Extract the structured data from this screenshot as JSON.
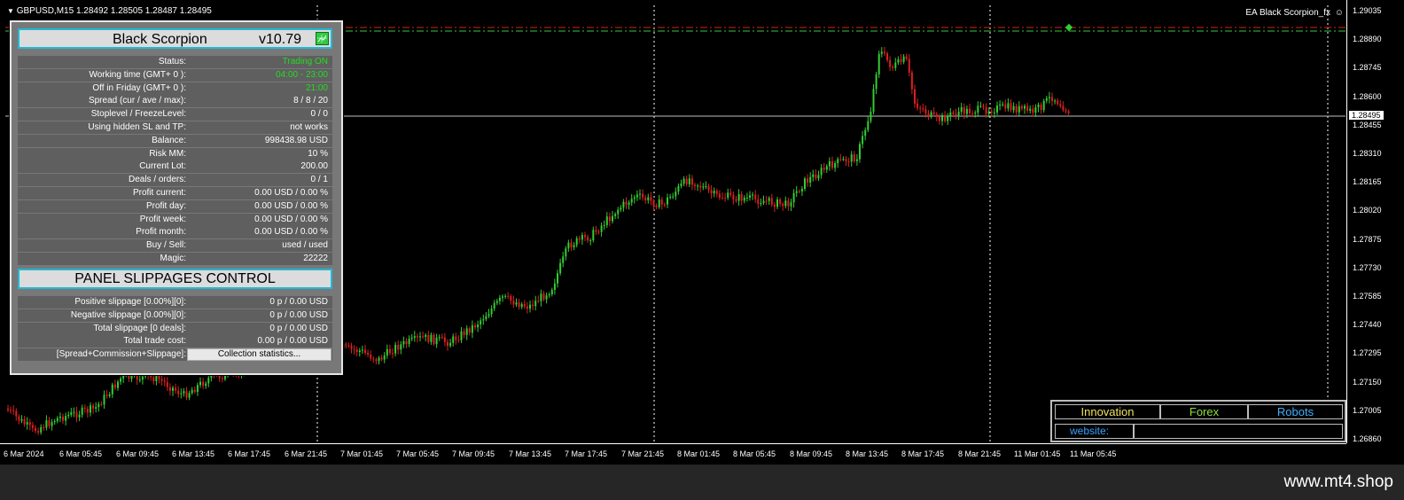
{
  "chart": {
    "symbol_header": "GBPUSD,M15  1.28492 1.28505 1.28487 1.28495",
    "ea_label": "EA Black Scorpion_fx",
    "current_price": "1.28495",
    "price_ticks": [
      "1.29035",
      "1.28890",
      "1.28745",
      "1.28600",
      "1.28455",
      "1.28310",
      "1.28165",
      "1.28020",
      "1.27875",
      "1.27730",
      "1.27585",
      "1.27440",
      "1.27295",
      "1.27150",
      "1.27005",
      "1.26860"
    ],
    "time_ticks": [
      "6 Mar 2024",
      "6 Mar 05:45",
      "6 Mar 09:45",
      "6 Mar 13:45",
      "6 Mar 17:45",
      "6 Mar 21:45",
      "7 Mar 01:45",
      "7 Mar 05:45",
      "7 Mar 09:45",
      "7 Mar 13:45",
      "7 Mar 17:45",
      "7 Mar 21:45",
      "8 Mar 01:45",
      "8 Mar 05:45",
      "8 Mar 09:45",
      "8 Mar 13:45",
      "8 Mar 17:45",
      "8 Mar 21:45",
      "11 Mar 01:45",
      "11 Mar 05:45"
    ],
    "colors": {
      "bull": "#32cd32",
      "bear": "#dc1e1e",
      "grid": "#ffffff",
      "bid_line": "#c0c0c0"
    }
  },
  "panel": {
    "title": "Black Scorpion",
    "version": "v10.79",
    "rows": [
      {
        "label": "Status:",
        "value": "Trading ON",
        "highlight": true
      },
      {
        "label": "Working time (GMT+ 0 ):",
        "value": "04:00 - 23:00",
        "highlight": true
      },
      {
        "label": "Off in Friday (GMT+ 0 ):",
        "value": "21:00",
        "highlight": true
      },
      {
        "label": "Spread (cur / ave / max):",
        "value": "8 / 8 / 20",
        "highlight": false
      },
      {
        "label": "Stoplevel  /  FreezeLevel:",
        "value": "0    /    0",
        "highlight": false
      },
      {
        "label": "Using hidden SL and TP:",
        "value": "not works",
        "highlight": false
      },
      {
        "label": "Balance:",
        "value": "998438.98  USD",
        "highlight": false
      },
      {
        "label": "Risk MM:",
        "value": "10 %",
        "highlight": false
      },
      {
        "label": "Current Lot:",
        "value": "200.00",
        "highlight": false
      },
      {
        "label": "Deals / orders:",
        "value": "0  /  1",
        "highlight": false
      },
      {
        "label": "Profit current:",
        "value": "0.00 USD / 0.00 %",
        "highlight": false
      },
      {
        "label": "Profit day:",
        "value": "0.00 USD / 0.00 %",
        "highlight": false
      },
      {
        "label": "Profit week:",
        "value": "0.00 USD / 0.00 %",
        "highlight": false
      },
      {
        "label": "Profit month:",
        "value": "0.00 USD / 0.00 %",
        "highlight": false
      },
      {
        "label": "Buy / Sell:",
        "value": "used  /  used",
        "highlight": false
      },
      {
        "label": "Magic:",
        "value": "22222",
        "highlight": false
      }
    ],
    "slippage_title": "PANEL SLIPPAGES CONTROL",
    "slippage_rows": [
      {
        "label": "Positive slippage [0.00%][0]:",
        "value": "0 p / 0.00 USD"
      },
      {
        "label": "Negative slippage [0.00%][0]:",
        "value": "0 p / 0.00 USD"
      },
      {
        "label": "Total slippage [0 deals]:",
        "value": "0 p / 0.00 USD"
      },
      {
        "label": "Total trade cost:",
        "value": "0.00 p / 0.00 USD"
      }
    ],
    "cost_label": "[Spread+Commission+Slippage]:",
    "collect_button": "Collection statistics..."
  },
  "brand_box": {
    "innovation": "Innovation",
    "forex": "Forex",
    "robots": "Robots",
    "website_label": "website:",
    "colors": {
      "innovation": "#f0e060",
      "forex": "#90e040",
      "robots": "#40b0ff"
    }
  },
  "footer": {
    "brand": "www.mt4.shop"
  }
}
